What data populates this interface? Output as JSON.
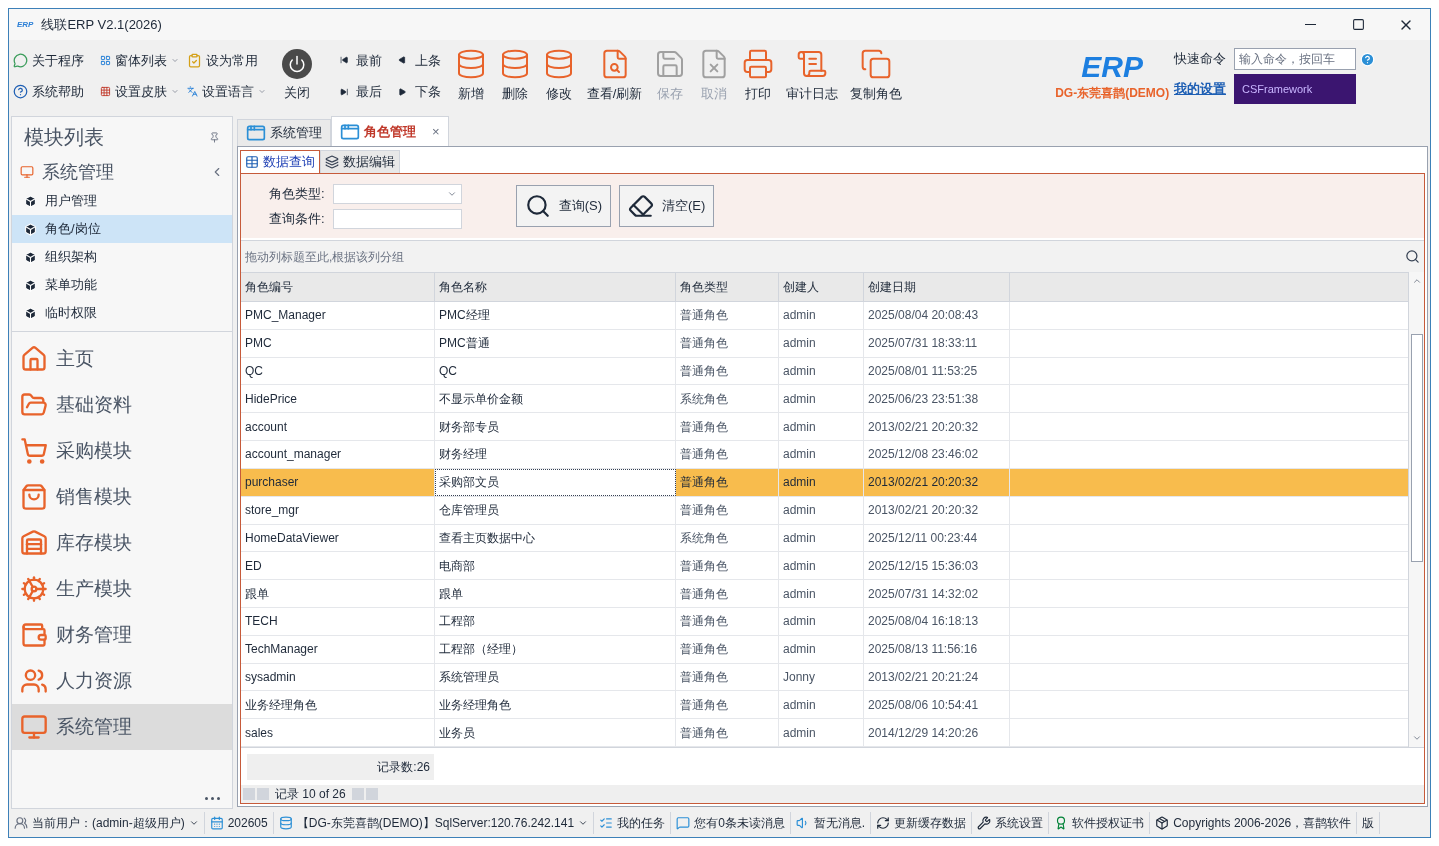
{
  "window": {
    "title": "线联ERP V2.1(2026)",
    "logo": "ERP"
  },
  "toolbar": {
    "left_commands": [
      {
        "label": "关于程序",
        "dropdown": false
      },
      {
        "label": "窗体列表",
        "dropdown": true
      },
      {
        "label": "设为常用",
        "dropdown": false
      },
      {
        "label": "系统帮助",
        "dropdown": false
      },
      {
        "label": "设置皮肤",
        "dropdown": true
      },
      {
        "label": "设置语言",
        "dropdown": true
      }
    ],
    "close": "关闭",
    "nav": [
      {
        "label": "最前"
      },
      {
        "label": "上条"
      },
      {
        "label": "最后"
      },
      {
        "label": "下条"
      }
    ],
    "actions": [
      {
        "label": "新增",
        "disabled": false
      },
      {
        "label": "删除",
        "disabled": false
      },
      {
        "label": "修改",
        "disabled": false
      },
      {
        "label": "查看/刷新",
        "disabled": false
      },
      {
        "label": "保存",
        "disabled": true
      },
      {
        "label": "取消",
        "disabled": true
      },
      {
        "label": "打印",
        "disabled": false
      },
      {
        "label": "审计日志",
        "disabled": false
      },
      {
        "label": "复制角色",
        "disabled": false
      }
    ]
  },
  "brand": {
    "logo": "ERP",
    "name": "DG-东莞喜鹊(DEMO)"
  },
  "quick_command": {
    "label": "快速命令",
    "placeholder": "输入命令，按回车",
    "settings_link": "我的设置",
    "banner": "CSFramework"
  },
  "sidebar": {
    "title": "模块列表",
    "group": {
      "label": "系统管理",
      "expanded": true,
      "items": [
        {
          "label": "用户管理",
          "selected": false
        },
        {
          "label": "角色/岗位",
          "selected": true
        },
        {
          "label": "组织架构",
          "selected": false
        },
        {
          "label": "菜单功能",
          "selected": false
        },
        {
          "label": "临时权限",
          "selected": false
        }
      ]
    },
    "modules": [
      {
        "label": "主页",
        "selected": false
      },
      {
        "label": "基础资料",
        "selected": false
      },
      {
        "label": "采购模块",
        "selected": false
      },
      {
        "label": "销售模块",
        "selected": false
      },
      {
        "label": "库存模块",
        "selected": false
      },
      {
        "label": "生产模块",
        "selected": false
      },
      {
        "label": "财务管理",
        "selected": false
      },
      {
        "label": "人力资源",
        "selected": false
      },
      {
        "label": "系统管理",
        "selected": true
      }
    ]
  },
  "tabs": [
    {
      "label": "系统管理",
      "selected": false,
      "closable": false
    },
    {
      "label": "角色管理",
      "selected": true,
      "closable": true
    }
  ],
  "close_glyph": "×",
  "subtabs": [
    {
      "label": "数据查询",
      "selected": true
    },
    {
      "label": "数据编辑",
      "selected": false
    }
  ],
  "filter": {
    "fields": [
      {
        "label": "角色类型:",
        "kind": "select"
      },
      {
        "label": "查询条件:",
        "kind": "text"
      }
    ],
    "buttons": [
      {
        "label": "查询(S)",
        "kind": "search"
      },
      {
        "label": "清空(E)",
        "kind": "clear"
      }
    ]
  },
  "group_hint": "拖动列标题至此,根据该列分组",
  "table": {
    "columns": [
      "角色编号",
      "角色名称",
      "角色类型",
      "创建人",
      "创建日期"
    ],
    "rows": [
      {
        "cells": [
          "PMC_Manager",
          "PMC经理",
          "普通角色",
          "admin",
          "2025/08/04 20:08:43"
        ],
        "selected": false
      },
      {
        "cells": [
          "PMC",
          "PMC普通",
          "普通角色",
          "admin",
          "2025/07/31 18:33:11"
        ],
        "selected": false
      },
      {
        "cells": [
          "QC",
          "QC",
          "普通角色",
          "admin",
          "2025/08/01 11:53:25"
        ],
        "selected": false
      },
      {
        "cells": [
          "HidePrice",
          "不显示单价金额",
          "系统角色",
          "admin",
          "2025/06/23 23:51:38"
        ],
        "selected": false
      },
      {
        "cells": [
          "account",
          "财务部专员",
          "普通角色",
          "admin",
          "2013/02/21 20:20:32"
        ],
        "selected": false
      },
      {
        "cells": [
          "account_manager",
          "财务经理",
          "普通角色",
          "admin",
          "2025/12/08 23:46:02"
        ],
        "selected": false
      },
      {
        "cells": [
          "purchaser",
          "采购部文员",
          "普通角色",
          "admin",
          "2013/02/21 20:20:32"
        ],
        "selected": true
      },
      {
        "cells": [
          "store_mgr",
          "仓库管理员",
          "普通角色",
          "admin",
          "2013/02/21 20:20:32"
        ],
        "selected": false
      },
      {
        "cells": [
          "HomeDataViewer",
          "查看主页数据中心",
          "系统角色",
          "admin",
          "2025/12/11 00:23:44"
        ],
        "selected": false
      },
      {
        "cells": [
          "ED",
          "电商部",
          "普通角色",
          "admin",
          "2025/12/15 15:36:03"
        ],
        "selected": false
      },
      {
        "cells": [
          "跟单",
          "跟单",
          "普通角色",
          "admin",
          "2025/07/31 14:32:02"
        ],
        "selected": false
      },
      {
        "cells": [
          "TECH",
          "工程部",
          "普通角色",
          "admin",
          "2025/08/04 16:18:13"
        ],
        "selected": false
      },
      {
        "cells": [
          "TechManager",
          "工程部（经理）",
          "普通角色",
          "admin",
          "2025/08/13 11:56:16"
        ],
        "selected": false
      },
      {
        "cells": [
          "sysadmin",
          "系统管理员",
          "普通角色",
          "Jonny",
          "2013/02/21 20:21:24"
        ],
        "selected": false
      },
      {
        "cells": [
          "业务经理角色",
          "业务经理角色",
          "普通角色",
          "admin",
          "2025/08/06 10:54:41"
        ],
        "selected": false
      },
      {
        "cells": [
          "sales",
          "业务员",
          "普通角色",
          "admin",
          "2014/12/29 14:20:26"
        ],
        "selected": false
      }
    ],
    "record_count": "记录数:26",
    "navigator": "记录 10 of 26"
  },
  "status_bar": [
    {
      "label": "当前用户：(admin-超级用户)",
      "dropdown": true
    },
    {
      "label": "202605",
      "dropdown": false
    },
    {
      "label": "【DG-东莞喜鹊(DEMO)】SqlServer:120.76.242.141",
      "dropdown": true
    },
    {
      "label": "我的任务",
      "dropdown": false
    },
    {
      "label": "您有0条未读消息",
      "dropdown": false
    },
    {
      "label": "暂无消息.",
      "dropdown": false
    },
    {
      "label": "更新缓存数据",
      "dropdown": false
    },
    {
      "label": "系统设置",
      "dropdown": false
    },
    {
      "label": "软件授权证书",
      "dropdown": false
    },
    {
      "label": "Copyrights 2006-2026，喜鹊软件",
      "dropdown": false
    },
    {
      "label": "版",
      "dropdown": false
    }
  ]
}
